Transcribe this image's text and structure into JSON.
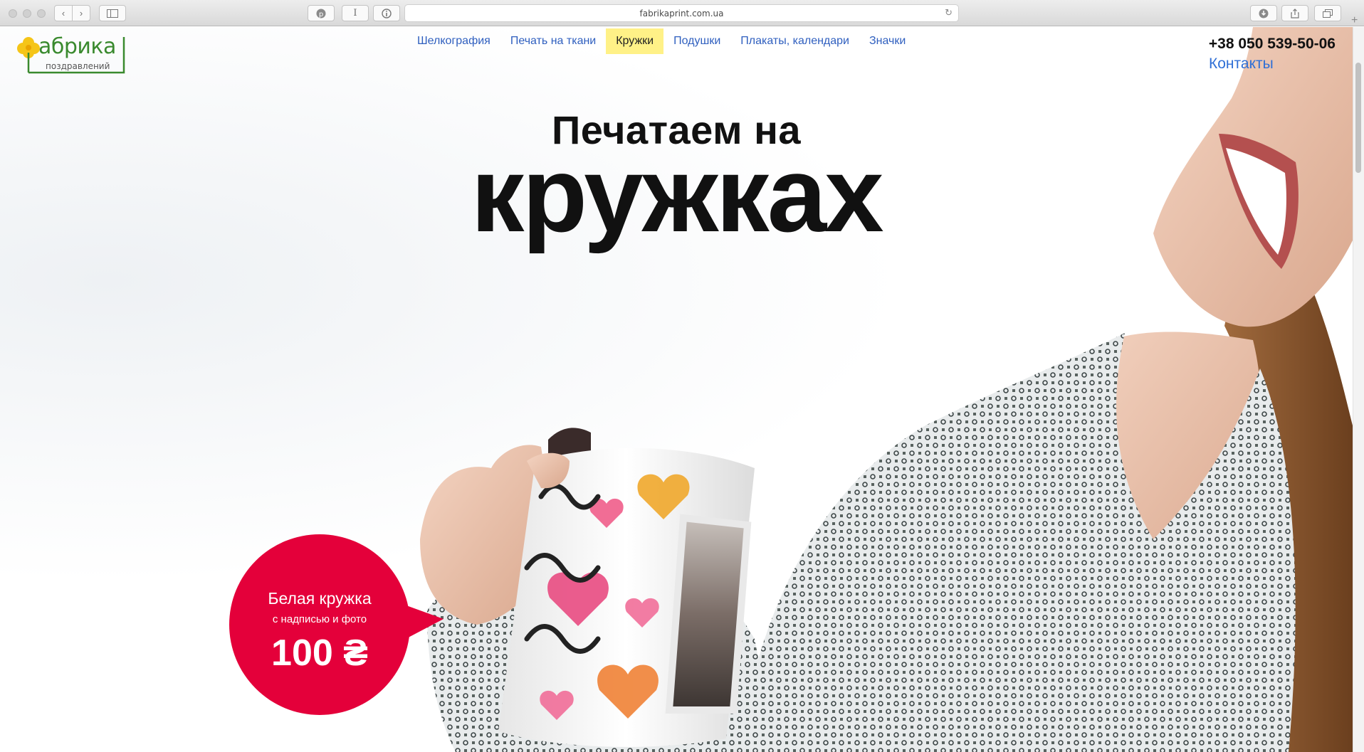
{
  "browser": {
    "url": "fabrikaprint.com.ua"
  },
  "site": {
    "logo": {
      "word": "абрика",
      "subtitle": "поздравлений"
    },
    "nav": [
      {
        "label": "Шелкография",
        "active": false
      },
      {
        "label": "Печать на ткани",
        "active": false
      },
      {
        "label": "Кружки",
        "active": true
      },
      {
        "label": "Подушки",
        "active": false
      },
      {
        "label": "Плакаты, календари",
        "active": false
      },
      {
        "label": "Значки",
        "active": false
      }
    ],
    "phone": "+38 050 539-50-06",
    "contacts_label": "Контакты"
  },
  "hero": {
    "line1": "Печатаем на",
    "line2": "кружках"
  },
  "offer": {
    "title": "Белая кружка",
    "subtitle": "с надписью и фото",
    "price": "100 ₴"
  },
  "colors": {
    "accent_red": "#e4003a",
    "nav_link": "#2f5fbf",
    "nav_active_bg": "#fff187",
    "logo_green": "#3a8a2e",
    "logo_yellow": "#f5c518"
  }
}
